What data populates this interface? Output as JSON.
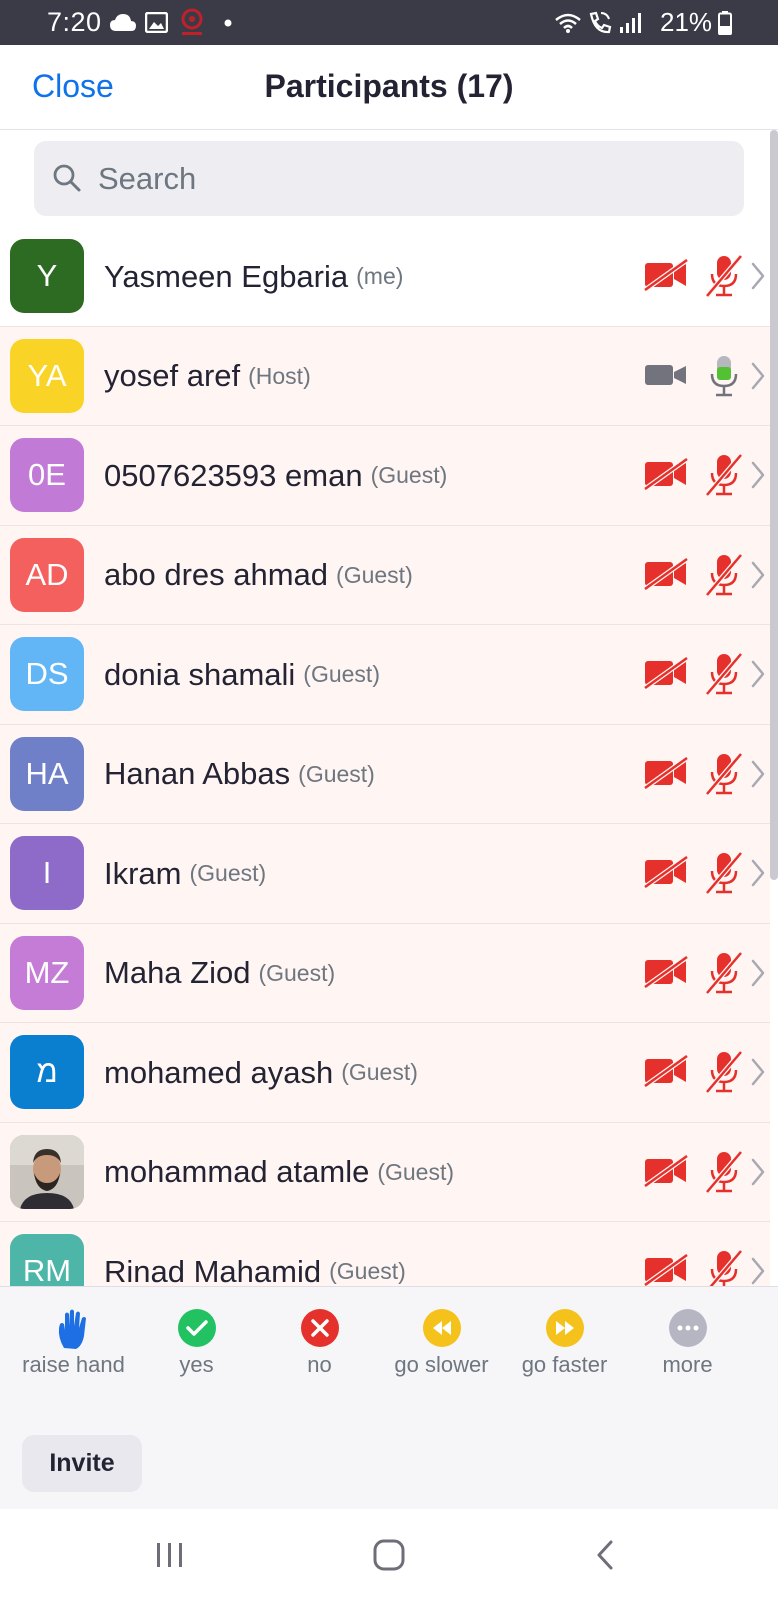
{
  "status_bar": {
    "time": "7:20",
    "battery": "21%",
    "icons": [
      "cloud-icon",
      "image-icon",
      "app-logo-icon",
      "dot-icon",
      "wifi-icon",
      "wifi-call-icon",
      "signal-icon",
      "battery-icon"
    ]
  },
  "header": {
    "close_label": "Close",
    "title": "Participants (17)"
  },
  "search": {
    "placeholder": "Search",
    "value": ""
  },
  "participants": [
    {
      "initials": "Y",
      "name": "Yasmeen Egbaria",
      "role": "(me)",
      "avatar_color": "#2e6b22",
      "video": "off",
      "audio": "muted"
    },
    {
      "initials": "YA",
      "name": "yosef aref",
      "role": "(Host)",
      "avatar_color": "#f9d427",
      "video": "on",
      "audio": "active"
    },
    {
      "initials": "0E",
      "name": "0507623593 eman",
      "role": "(Guest)",
      "avatar_color": "#c17ad6",
      "video": "off",
      "audio": "muted"
    },
    {
      "initials": "AD",
      "name": "abo dres ahmad",
      "role": "(Guest)",
      "avatar_color": "#f4605d",
      "video": "off",
      "audio": "muted"
    },
    {
      "initials": "DS",
      "name": "donia shamali",
      "role": "(Guest)",
      "avatar_color": "#62b6f6",
      "video": "off",
      "audio": "muted"
    },
    {
      "initials": "HA",
      "name": "Hanan Abbas",
      "role": "(Guest)",
      "avatar_color": "#6f80c9",
      "video": "off",
      "audio": "muted"
    },
    {
      "initials": "I",
      "name": "Ikram",
      "role": "(Guest)",
      "avatar_color": "#8e6bc8",
      "video": "off",
      "audio": "muted"
    },
    {
      "initials": "MZ",
      "name": "Maha Ziod",
      "role": "(Guest)",
      "avatar_color": "#c47cd6",
      "video": "off",
      "audio": "muted"
    },
    {
      "initials": "מ",
      "name": "mohamed ayash",
      "role": "(Guest)",
      "avatar_color": "#0a7fcf",
      "video": "off",
      "audio": "muted"
    },
    {
      "initials": "",
      "name": "mohammad atamle",
      "role": "(Guest)",
      "avatar_color": "#b8b2ab",
      "avatar_photo": "photo",
      "video": "off",
      "audio": "muted"
    },
    {
      "initials": "RM",
      "name": "Rinad Mahamid",
      "role": "(Guest)",
      "avatar_color": "#4db6a8",
      "video": "off",
      "audio": "muted"
    }
  ],
  "reactions": [
    {
      "label": "raise hand",
      "icon": "raise-hand-icon",
      "color": "#1d6fe3"
    },
    {
      "label": "yes",
      "icon": "check-icon",
      "color": "#22c263"
    },
    {
      "label": "no",
      "icon": "x-icon",
      "color": "#e5302b"
    },
    {
      "label": "go slower",
      "icon": "rewind-icon",
      "color": "#f4c21b"
    },
    {
      "label": "go faster",
      "icon": "fast-forward-icon",
      "color": "#f4c21b"
    },
    {
      "label": "more",
      "icon": "more-icon",
      "color": "#b6b6c2"
    }
  ],
  "invite_label": "Invite",
  "colors": {
    "accent": "#0e72ed",
    "muted_red": "#e5302b",
    "mic_active": "#52c234",
    "row_tint": "#fff5f3"
  }
}
